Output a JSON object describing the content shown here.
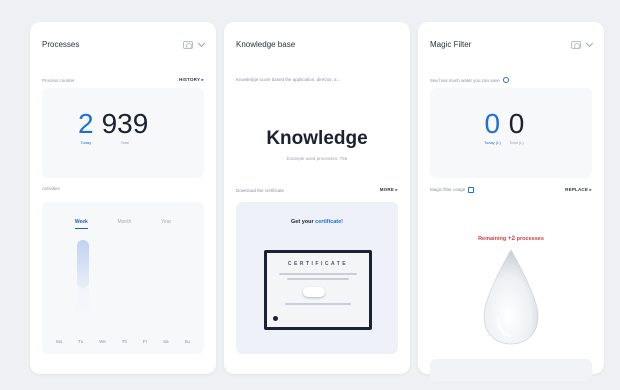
{
  "processes": {
    "title": "Processes",
    "row_label": "Process counter",
    "row_link": "HISTORY",
    "today_value": "2",
    "today_label": "Today",
    "total_value": "939",
    "total_label": "Total",
    "activities_label": "Activities",
    "tabs": [
      "Week",
      "Month",
      "Year"
    ],
    "active_tab": "Week",
    "days": [
      "Mo",
      "Tu",
      "We",
      "Th",
      "Fr",
      "Sa",
      "Su"
    ],
    "week_level": 0.6
  },
  "knowledge": {
    "title": "Knowledge base",
    "row_label": "Knowledge score based the application, director, a...",
    "big_word": "Knowledge",
    "sub_text": "Example used processes: 756",
    "row2_label": "Download the certificate",
    "row2_link": "MORE",
    "cert_title_prefix": "Get your ",
    "cert_title_highlight": "certificate!",
    "cert_heading": "CERTIFICATE"
  },
  "magic": {
    "title": "Magic Filter",
    "row_label": "See how much water you can save",
    "today_value": "0",
    "today_label": "Today (L)",
    "total_value": "0",
    "total_label": "Total (L)",
    "row2_label": "Magic filter usage",
    "row2_link": "REPLACE",
    "remain_prefix": "Remaining ",
    "remain_count": "+2",
    "remain_suffix": " processes"
  },
  "colors": {
    "accent": "#1f6fd6",
    "warning": "#e04040",
    "background": "#eef0f3"
  },
  "icons": {
    "card_settings": "image-icon",
    "dropdown": "chevron-down-icon",
    "help": "info-icon",
    "drop": "water-drop-icon"
  }
}
